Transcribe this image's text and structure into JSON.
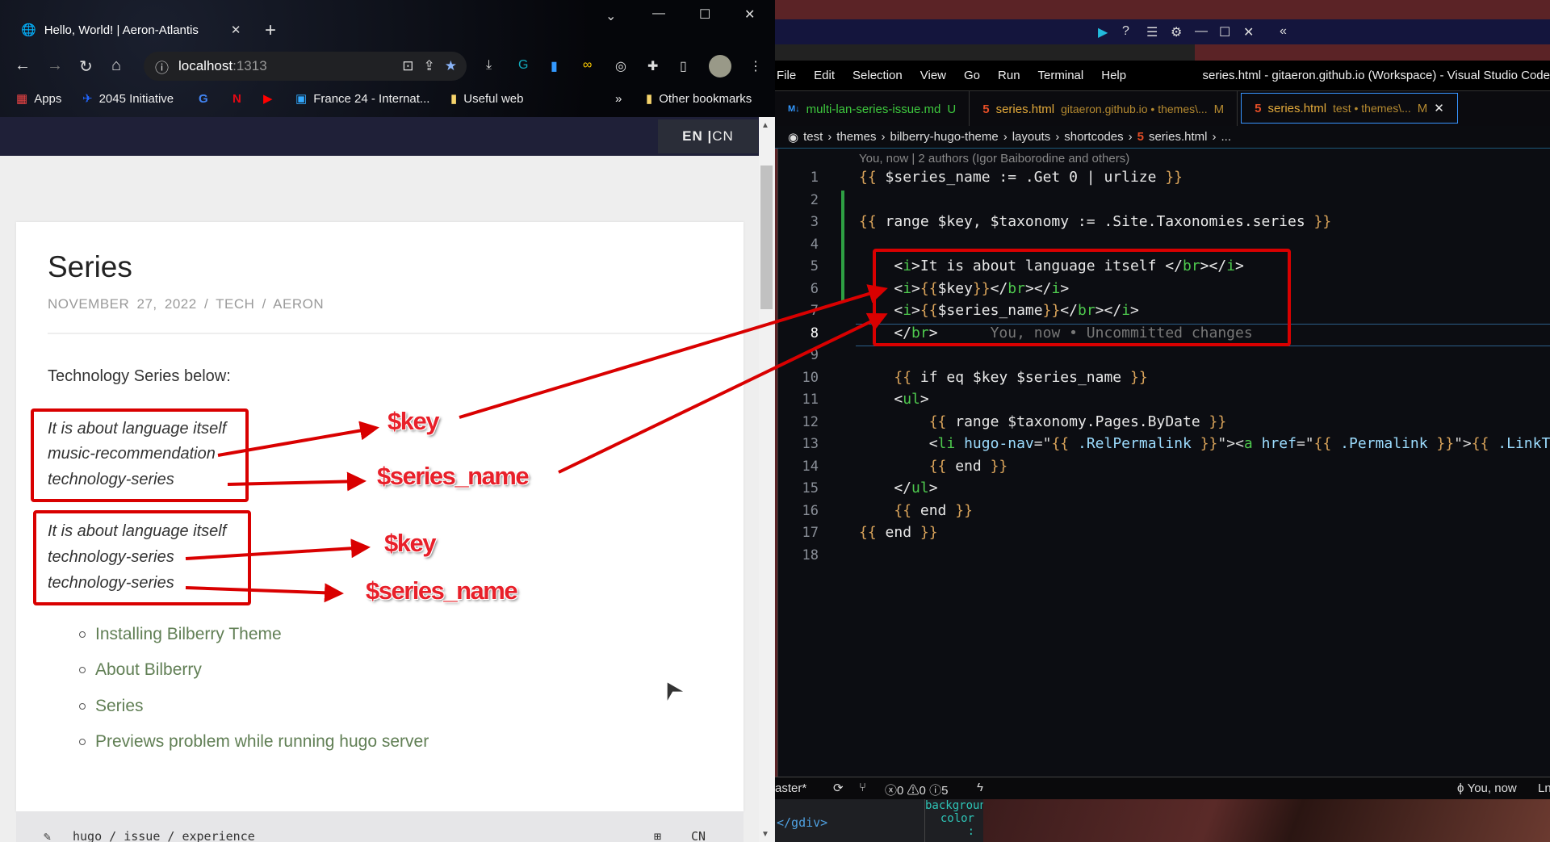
{
  "browser": {
    "tab_title": "Hello, World! | Aeron-Atlantis",
    "url_host": "localhost",
    "url_port": ":1313",
    "bookmarks": [
      "Apps",
      "2045 Initiative",
      "France 24 - Internat...",
      "Useful web"
    ],
    "other_bookmarks": "Other bookmarks",
    "more": "»",
    "lang_en": "EN",
    "lang_sep": "|",
    "lang_cn": "CN"
  },
  "page": {
    "title": "Series",
    "meta": {
      "date": "NOVEMBER 27, 2022",
      "category": "TECH",
      "author": "AERON",
      "sep": "/"
    },
    "intro": "Technology Series below:",
    "group1": [
      "It is about language itself",
      "music-recommendation",
      "technology-series"
    ],
    "group2": [
      "It is about language itself",
      "technology-series",
      "technology-series"
    ],
    "links": [
      "Installing Bilberry Theme",
      "About Bilberry",
      "Series",
      "Previews problem while running hugo server"
    ],
    "footer_tags": "hugo / issue / experience",
    "footer_lang": "CN"
  },
  "annotations": {
    "key": "$key",
    "series_name": "$series_name",
    "color": "#d90000"
  },
  "vscode": {
    "menu": [
      "File",
      "Edit",
      "Selection",
      "View",
      "Go",
      "Run",
      "Terminal",
      "Help"
    ],
    "window_title": "series.html - gitaeron.github.io (Workspace) - Visual Studio Code",
    "tabs": [
      {
        "name": "multi-lan-series-issue.md",
        "desc": "",
        "badge": "U",
        "color": "#3ec93e"
      },
      {
        "name": "series.html",
        "desc": "gitaeron.github.io • themes\\...",
        "badge": "M",
        "color": "#e2a93a"
      },
      {
        "name": "series.html",
        "desc": "test • themes\\...",
        "badge": "M",
        "color": "#e2a93a",
        "active": true
      }
    ],
    "breadcrumb": [
      "test",
      "themes",
      "bilberry-hugo-theme",
      "layouts",
      "shortcodes",
      "series.html",
      "..."
    ],
    "codelens": "You, now | 2 authors (Igor Baiborodine and others)",
    "code": [
      [
        [
          "{{",
          "br"
        ],
        [
          " $series_name := .Get 0 | urlize ",
          "txt"
        ],
        [
          "}}",
          "br"
        ]
      ],
      [],
      [
        [
          "{{",
          "br"
        ],
        [
          " range $key, $taxonomy := .Site.Taxonomies.series ",
          "txt"
        ],
        [
          "}}",
          "br"
        ]
      ],
      [],
      [
        [
          "    <",
          "txt"
        ],
        [
          "i",
          "tag"
        ],
        [
          ">It is about language itself </",
          "txt"
        ],
        [
          "br",
          "tag"
        ],
        [
          "></",
          "txt"
        ],
        [
          "i",
          "tag"
        ],
        [
          ">",
          "txt"
        ]
      ],
      [
        [
          "    <",
          "txt"
        ],
        [
          "i",
          "tag"
        ],
        [
          ">",
          "txt"
        ],
        [
          "{{",
          "br"
        ],
        [
          "$key",
          "txt"
        ],
        [
          "}}",
          "br"
        ],
        [
          "</",
          "txt"
        ],
        [
          "br",
          "tag"
        ],
        [
          "></",
          "txt"
        ],
        [
          "i",
          "tag"
        ],
        [
          ">",
          "txt"
        ]
      ],
      [
        [
          "    <",
          "txt"
        ],
        [
          "i",
          "tag"
        ],
        [
          ">",
          "txt"
        ],
        [
          "{{",
          "br"
        ],
        [
          "$series_name",
          "txt"
        ],
        [
          "}}",
          "br"
        ],
        [
          "</",
          "txt"
        ],
        [
          "br",
          "tag"
        ],
        [
          "></",
          "txt"
        ],
        [
          "i",
          "tag"
        ],
        [
          ">",
          "txt"
        ]
      ],
      [
        [
          "    </",
          "txt"
        ],
        [
          "br",
          "tag"
        ],
        [
          ">",
          "txt"
        ],
        [
          "      You, now • Uncommitted changes",
          "ghost"
        ]
      ],
      [],
      [
        [
          "    ",
          "txt"
        ],
        [
          "{{",
          "br"
        ],
        [
          " if eq $key $series_name ",
          "txt"
        ],
        [
          "}}",
          "br"
        ]
      ],
      [
        [
          "    <",
          "txt"
        ],
        [
          "ul",
          "tag"
        ],
        [
          ">",
          "txt"
        ]
      ],
      [
        [
          "        ",
          "txt"
        ],
        [
          "{{",
          "br"
        ],
        [
          " range $taxonomy.Pages.ByDate ",
          "txt"
        ],
        [
          "}}",
          "br"
        ]
      ],
      [
        [
          "        <",
          "txt"
        ],
        [
          "li",
          "tag"
        ],
        [
          " ",
          "txt"
        ],
        [
          "hugo-nav",
          "attr"
        ],
        [
          "=\"",
          "q"
        ],
        [
          "{{",
          "br"
        ],
        [
          " .RelPermalink ",
          "attr"
        ],
        [
          "}}",
          "br"
        ],
        [
          "\"><",
          "q"
        ],
        [
          "a",
          "tag"
        ],
        [
          " ",
          "txt"
        ],
        [
          "href",
          "attr"
        ],
        [
          "=\"",
          "q"
        ],
        [
          "{{",
          "br"
        ],
        [
          " .Permalink ",
          "attr"
        ],
        [
          "}}",
          "br"
        ],
        [
          "\">",
          "q"
        ],
        [
          "{{",
          "br"
        ],
        [
          " .LinkTitle",
          "attr"
        ]
      ],
      [
        [
          "        ",
          "txt"
        ],
        [
          "{{",
          "br"
        ],
        [
          " end ",
          "txt"
        ],
        [
          "}}",
          "br"
        ]
      ],
      [
        [
          "    </",
          "txt"
        ],
        [
          "ul",
          "tag"
        ],
        [
          ">",
          "txt"
        ]
      ],
      [
        [
          "    ",
          "txt"
        ],
        [
          "{{",
          "br"
        ],
        [
          " end ",
          "txt"
        ],
        [
          "}}",
          "br"
        ]
      ],
      [
        [
          "{{",
          "br"
        ],
        [
          " end ",
          "txt"
        ],
        [
          "}}",
          "br"
        ]
      ],
      []
    ],
    "current_line": 8,
    "status": {
      "branch": "aster*",
      "errors": "0",
      "warnings": "0",
      "info": "5",
      "blame": "You, now",
      "pos": "Ln"
    },
    "bottom_code": "</gdiv>",
    "bottom_css": "background-color",
    "bottom_colon": ":"
  }
}
